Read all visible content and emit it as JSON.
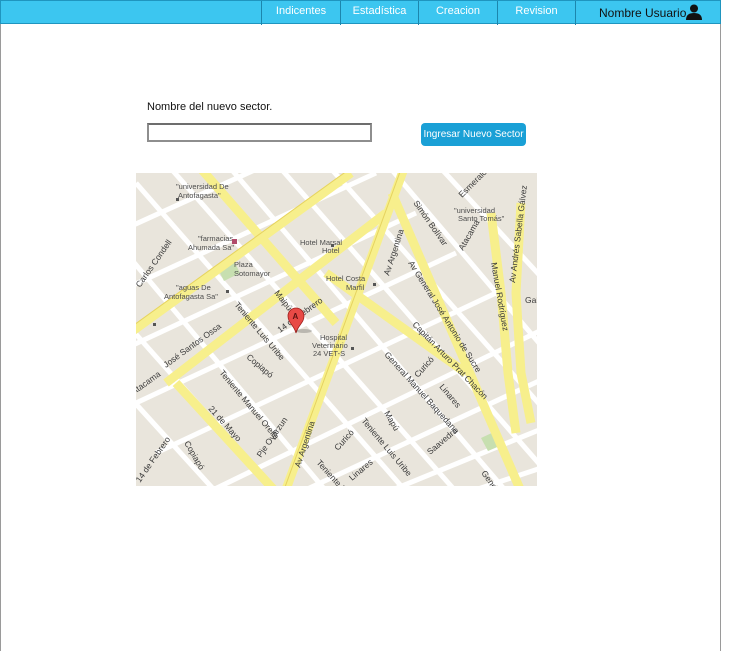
{
  "nav": {
    "items": [
      {
        "label": "Indicentes"
      },
      {
        "label": "Estadística"
      },
      {
        "label": "Creacion Sector"
      },
      {
        "label": "Revision Sector"
      }
    ],
    "user_label": "Nombre Usuario",
    "user_icon": "user-icon"
  },
  "form": {
    "label": "Nombre del nuevo sector.",
    "input_value": "",
    "input_placeholder": "",
    "submit_label": "Ingresar Nuevo Sector"
  },
  "map": {
    "marker_label": "A",
    "labels": [
      {
        "text": "\"universidad De"
      },
      {
        "text": "Antofagasta\""
      },
      {
        "text": "\"farmacias"
      },
      {
        "text": "Ahumada Sa\""
      },
      {
        "text": "Plaza"
      },
      {
        "text": "Sotomayor"
      },
      {
        "text": "\"aguas De"
      },
      {
        "text": "Antofagasta Sa\""
      },
      {
        "text": "Hotel Marsal"
      },
      {
        "text": "Hotel"
      },
      {
        "text": "Hotel Costa"
      },
      {
        "text": "Marfil"
      },
      {
        "text": "Hospital"
      },
      {
        "text": "Veterinario"
      },
      {
        "text": "24 VET-S"
      },
      {
        "text": "\"universidad"
      },
      {
        "text": "Santo Tomás\""
      }
    ],
    "streets": [
      {
        "text": "Carlos Condell"
      },
      {
        "text": "José Santos Ossa"
      },
      {
        "text": "Teniente Luis Uribe"
      },
      {
        "text": "Maipú"
      },
      {
        "text": "14 de Febrero"
      },
      {
        "text": "Av Argentina"
      },
      {
        "text": "Simón Bolívar"
      },
      {
        "text": "Esmeralda"
      },
      {
        "text": "Atacama"
      },
      {
        "text": "Av General José Antonio de Sucre"
      },
      {
        "text": "Manuel Rodríguez"
      },
      {
        "text": "Av Andrés Sabella Gálvez"
      },
      {
        "text": "Capitán Arturo Prat Chacón"
      },
      {
        "text": "General Manuel Baquedano"
      },
      {
        "text": "Linares"
      },
      {
        "text": "Curicó"
      },
      {
        "text": "Teniente Manuel Orella"
      },
      {
        "text": "21 de Mayo"
      },
      {
        "text": "Copiapó"
      },
      {
        "text": "Pje Ovarzun"
      },
      {
        "text": "Av Argentina"
      },
      {
        "text": "Curicó"
      },
      {
        "text": "Teniente Luis Uribe"
      },
      {
        "text": "Mapú"
      },
      {
        "text": "Saavedra"
      },
      {
        "text": "Teniente M"
      },
      {
        "text": "Linares"
      },
      {
        "text": "Gene"
      },
      {
        "text": "14 de Febrero"
      },
      {
        "text": "Atacama"
      },
      {
        "text": "Gal"
      },
      {
        "text": "Copiapó"
      }
    ]
  }
}
